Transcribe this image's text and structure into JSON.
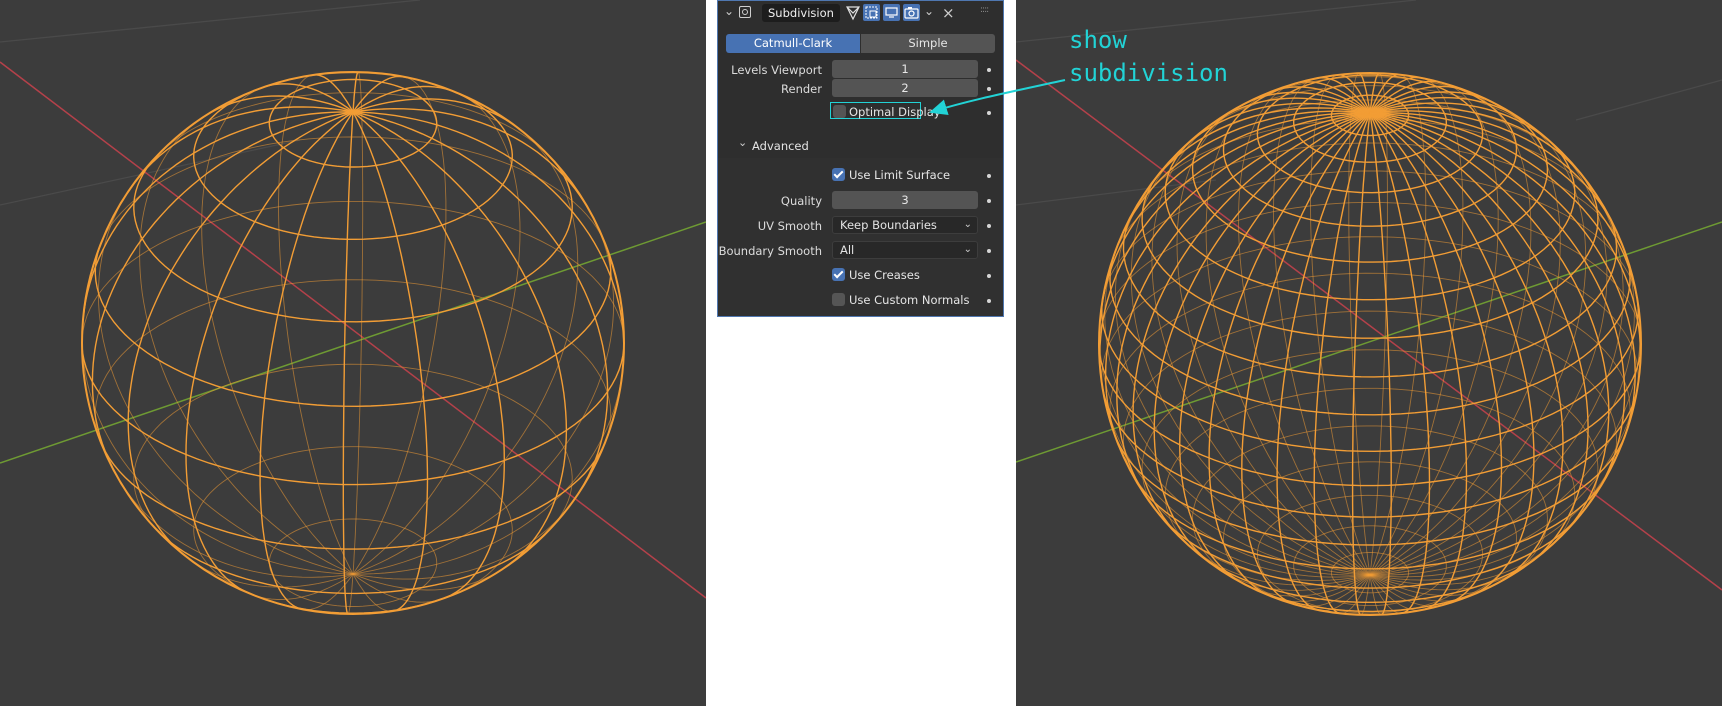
{
  "modifier": {
    "name": "Subdivision",
    "icons": [
      "collapse-chevron-icon",
      "modifier-type-icon",
      "edit-mode-icon",
      "on-cage-icon",
      "viewport-display-icon",
      "render-camera-icon",
      "dropdown-chevron-icon",
      "close-icon",
      "drag-handle-icon"
    ]
  },
  "mode_tabs": [
    {
      "label": "Catmull-Clark",
      "active": true
    },
    {
      "label": "Simple",
      "active": false
    }
  ],
  "levels": {
    "viewport_label": "Levels Viewport",
    "viewport_value": "1",
    "render_label": "Render",
    "render_value": "2"
  },
  "optimal_display": {
    "label": "Optimal Display",
    "checked": false
  },
  "advanced": {
    "header": "Advanced",
    "use_limit_surface": {
      "label": "Use Limit Surface",
      "checked": true
    },
    "quality_label": "Quality",
    "quality_value": "3",
    "uv_smooth_label": "UV Smooth",
    "uv_smooth_value": "Keep Boundaries",
    "boundary_smooth_label": "Boundary Smooth",
    "boundary_smooth_value": "All",
    "use_creases": {
      "label": "Use Creases",
      "checked": true
    },
    "use_custom_normals": {
      "label": "Use Custom Normals",
      "checked": false
    }
  },
  "annotation": {
    "line1": "show",
    "line2": "subdivision",
    "color": "#22d3d6"
  },
  "colors": {
    "viewport_bg": "#3c3c3c",
    "wire": "#f29d35",
    "x_axis": "#b4414a",
    "y_axis": "#6e9a33",
    "accent": "#4772b3"
  }
}
